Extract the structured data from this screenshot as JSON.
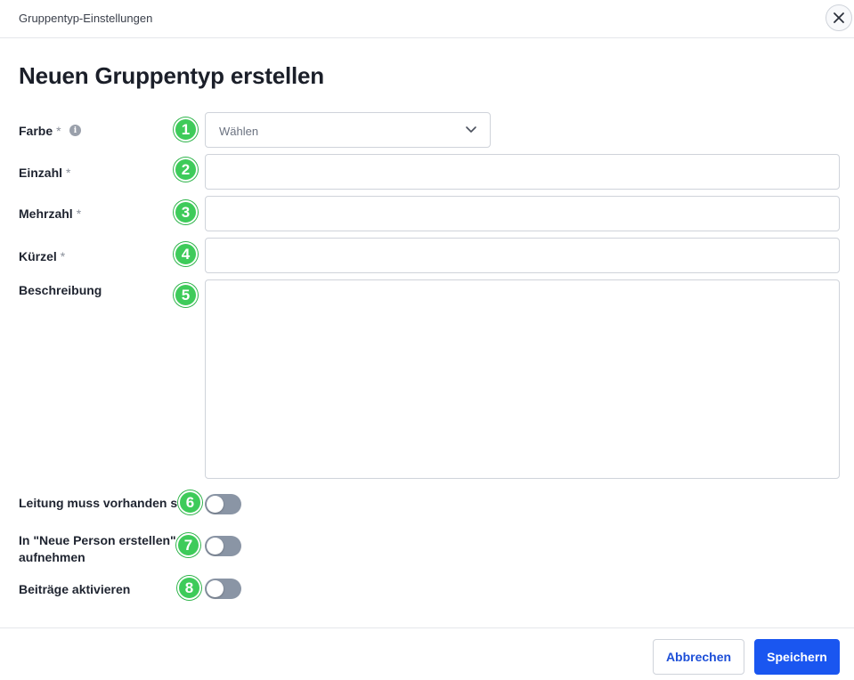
{
  "dialog": {
    "title": "Gruppentyp-Einstellungen",
    "close_icon": "close-icon"
  },
  "page_title": "Neuen Gruppentyp erstellen",
  "required_marker": "*",
  "fields": {
    "farbe": {
      "label": "Farbe",
      "required": true,
      "badge": "1",
      "placeholder": "Wählen",
      "info_icon": "info-icon"
    },
    "einzahl": {
      "label": "Einzahl",
      "required": true,
      "badge": "2",
      "value": ""
    },
    "mehrzahl": {
      "label": "Mehrzahl",
      "required": true,
      "badge": "3",
      "value": ""
    },
    "kuerzel": {
      "label": "Kürzel",
      "required": true,
      "badge": "4",
      "value": ""
    },
    "beschreibung": {
      "label": "Beschreibung",
      "required": false,
      "badge": "5",
      "value": ""
    }
  },
  "toggles": {
    "leitung": {
      "label": "Leitung muss vorhanden sein",
      "badge": "6",
      "on": false
    },
    "neue_person": {
      "label": "In \"Neue Person erstellen\" aufnehmen",
      "badge": "7",
      "on": false
    },
    "beitraege": {
      "label": "Beiträge aktivieren",
      "badge": "8",
      "on": false
    }
  },
  "footer": {
    "cancel_label": "Abbrechen",
    "save_label": "Speichern"
  },
  "colors": {
    "accent": "#1a56f0",
    "badge": "#3ecb5a",
    "toggle_off": "#8a95a5"
  }
}
